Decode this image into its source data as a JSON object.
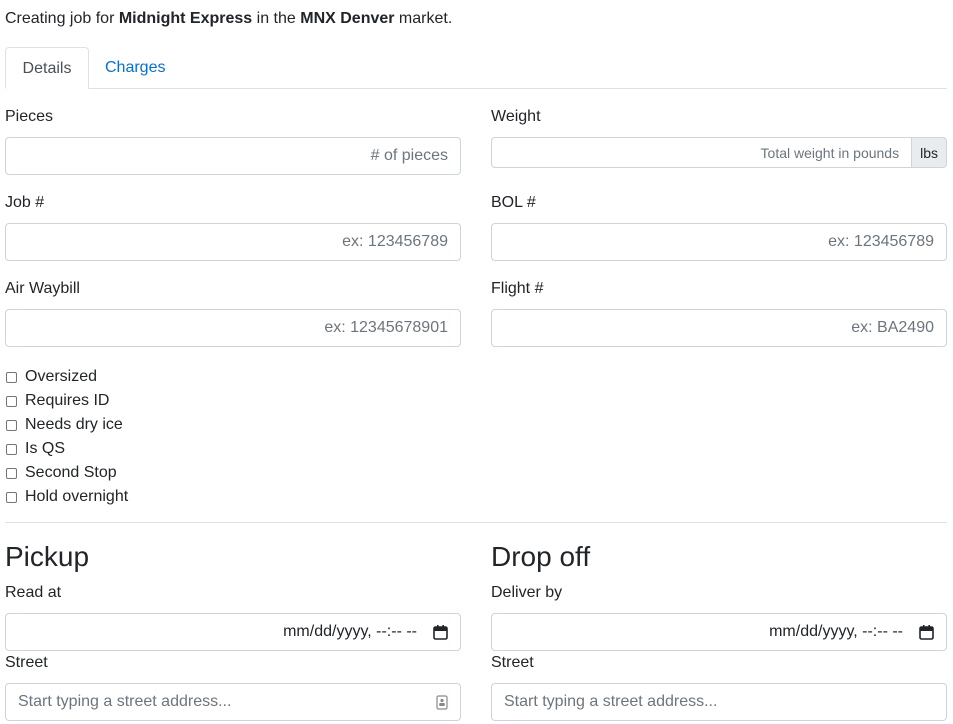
{
  "intro": {
    "prefix": "Creating job for ",
    "company": "Midnight Express",
    "middle": " in the ",
    "market": "MNX Denver",
    "suffix": " market."
  },
  "tabs": [
    {
      "label": "Details",
      "active": true
    },
    {
      "label": "Charges",
      "active": false
    }
  ],
  "fields": {
    "pieces": {
      "label": "Pieces",
      "placeholder": "# of pieces",
      "value": ""
    },
    "weight": {
      "label": "Weight",
      "placeholder": "Total weight in pounds",
      "unit": "lbs",
      "value": ""
    },
    "job": {
      "label": "Job #",
      "placeholder": "ex: 123456789",
      "value": ""
    },
    "bol": {
      "label": "BOL #",
      "placeholder": "ex: 123456789",
      "value": ""
    },
    "air_waybill": {
      "label": "Air Waybill",
      "placeholder": "ex: 12345678901",
      "value": ""
    },
    "flight": {
      "label": "Flight #",
      "placeholder": "ex: BA2490",
      "value": ""
    }
  },
  "checkboxes": [
    {
      "label": "Oversized",
      "checked": false
    },
    {
      "label": "Requires ID",
      "checked": false
    },
    {
      "label": "Needs dry ice",
      "checked": false
    },
    {
      "label": "Is QS",
      "checked": false
    },
    {
      "label": "Second Stop",
      "checked": false
    },
    {
      "label": "Hold overnight",
      "checked": false
    }
  ],
  "pickup": {
    "heading": "Pickup",
    "time_label": "Read at",
    "time_placeholder": "mm/dd/yyyy, --:-- --",
    "street_label": "Street",
    "street_placeholder": "Start typing a street address..."
  },
  "dropoff": {
    "heading": "Drop off",
    "time_label": "Deliver by",
    "time_placeholder": "mm/dd/yyyy, --:-- --",
    "street_label": "Street",
    "street_placeholder": "Start typing a street address..."
  }
}
